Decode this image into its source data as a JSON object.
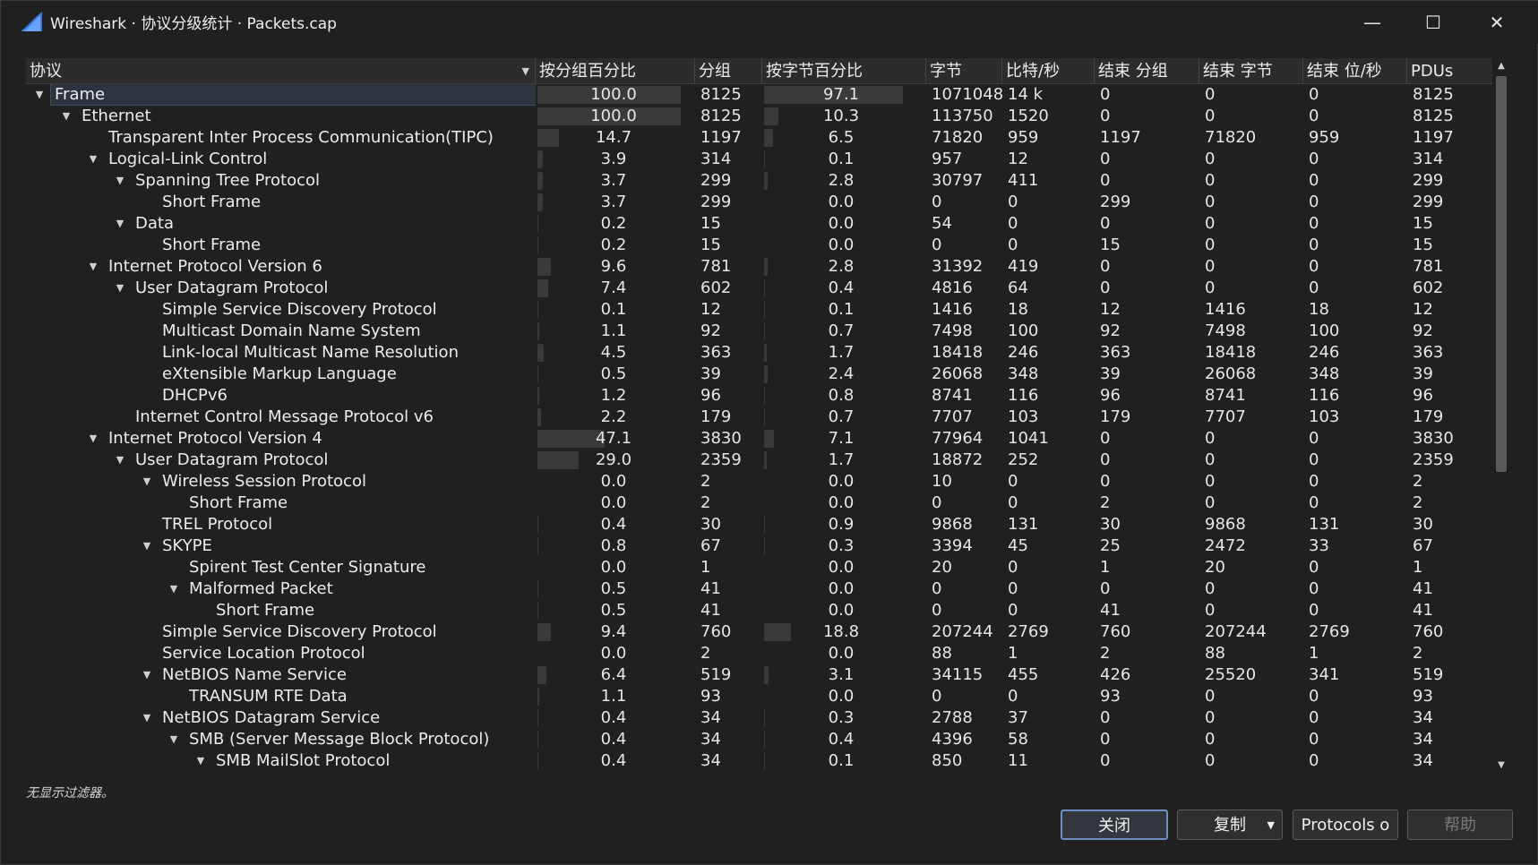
{
  "window": {
    "title": "Wireshark · 协议分级统计 · Packets.cap",
    "min_icon": "minimize-icon",
    "max_icon": "maximize-icon",
    "close_icon": "close-icon"
  },
  "columns": {
    "protocol": "协议",
    "pct_packets": "按分组百分比",
    "packets": "分组",
    "pct_bytes": "按字节百分比",
    "bytes": "字节",
    "bps": "比特/秒",
    "end_packets": "结束 分组",
    "end_bytes": "结束 字节",
    "end_bps": "结束 位/秒",
    "pdus": "PDUs"
  },
  "rows": [
    {
      "name": "Frame",
      "level": 0,
      "expanded": true,
      "pct": "100.0",
      "pkts": "8125",
      "bpct": "97.1",
      "bytes": "1071048",
      "bps": "14 k",
      "epk": "0",
      "eby": "0",
      "ebps": "0",
      "pdus": "8125",
      "selected": true
    },
    {
      "name": "Ethernet",
      "level": 1,
      "expanded": true,
      "pct": "100.0",
      "pkts": "8125",
      "bpct": "10.3",
      "bytes": "113750",
      "bps": "1520",
      "epk": "0",
      "eby": "0",
      "ebps": "0",
      "pdus": "8125"
    },
    {
      "name": "Transparent Inter Process Communication(TIPC)",
      "level": 2,
      "expanded": null,
      "pct": "14.7",
      "pkts": "1197",
      "bpct": "6.5",
      "bytes": "71820",
      "bps": "959",
      "epk": "1197",
      "eby": "71820",
      "ebps": "959",
      "pdus": "1197"
    },
    {
      "name": "Logical-Link Control",
      "level": 2,
      "expanded": true,
      "pct": "3.9",
      "pkts": "314",
      "bpct": "0.1",
      "bytes": "957",
      "bps": "12",
      "epk": "0",
      "eby": "0",
      "ebps": "0",
      "pdus": "314"
    },
    {
      "name": "Spanning Tree Protocol",
      "level": 3,
      "expanded": true,
      "pct": "3.7",
      "pkts": "299",
      "bpct": "2.8",
      "bytes": "30797",
      "bps": "411",
      "epk": "0",
      "eby": "0",
      "ebps": "0",
      "pdus": "299"
    },
    {
      "name": "Short Frame",
      "level": 4,
      "expanded": null,
      "pct": "3.7",
      "pkts": "299",
      "bpct": "0.0",
      "bytes": "0",
      "bps": "0",
      "epk": "299",
      "eby": "0",
      "ebps": "0",
      "pdus": "299"
    },
    {
      "name": "Data",
      "level": 3,
      "expanded": true,
      "pct": "0.2",
      "pkts": "15",
      "bpct": "0.0",
      "bytes": "54",
      "bps": "0",
      "epk": "0",
      "eby": "0",
      "ebps": "0",
      "pdus": "15"
    },
    {
      "name": "Short Frame",
      "level": 4,
      "expanded": null,
      "pct": "0.2",
      "pkts": "15",
      "bpct": "0.0",
      "bytes": "0",
      "bps": "0",
      "epk": "15",
      "eby": "0",
      "ebps": "0",
      "pdus": "15"
    },
    {
      "name": "Internet Protocol Version 6",
      "level": 2,
      "expanded": true,
      "pct": "9.6",
      "pkts": "781",
      "bpct": "2.8",
      "bytes": "31392",
      "bps": "419",
      "epk": "0",
      "eby": "0",
      "ebps": "0",
      "pdus": "781"
    },
    {
      "name": "User Datagram Protocol",
      "level": 3,
      "expanded": true,
      "pct": "7.4",
      "pkts": "602",
      "bpct": "0.4",
      "bytes": "4816",
      "bps": "64",
      "epk": "0",
      "eby": "0",
      "ebps": "0",
      "pdus": "602"
    },
    {
      "name": "Simple Service Discovery Protocol",
      "level": 4,
      "expanded": null,
      "pct": "0.1",
      "pkts": "12",
      "bpct": "0.1",
      "bytes": "1416",
      "bps": "18",
      "epk": "12",
      "eby": "1416",
      "ebps": "18",
      "pdus": "12"
    },
    {
      "name": "Multicast Domain Name System",
      "level": 4,
      "expanded": null,
      "pct": "1.1",
      "pkts": "92",
      "bpct": "0.7",
      "bytes": "7498",
      "bps": "100",
      "epk": "92",
      "eby": "7498",
      "ebps": "100",
      "pdus": "92"
    },
    {
      "name": "Link-local Multicast Name Resolution",
      "level": 4,
      "expanded": null,
      "pct": "4.5",
      "pkts": "363",
      "bpct": "1.7",
      "bytes": "18418",
      "bps": "246",
      "epk": "363",
      "eby": "18418",
      "ebps": "246",
      "pdus": "363"
    },
    {
      "name": "eXtensible Markup Language",
      "level": 4,
      "expanded": null,
      "pct": "0.5",
      "pkts": "39",
      "bpct": "2.4",
      "bytes": "26068",
      "bps": "348",
      "epk": "39",
      "eby": "26068",
      "ebps": "348",
      "pdus": "39"
    },
    {
      "name": "DHCPv6",
      "level": 4,
      "expanded": null,
      "pct": "1.2",
      "pkts": "96",
      "bpct": "0.8",
      "bytes": "8741",
      "bps": "116",
      "epk": "96",
      "eby": "8741",
      "ebps": "116",
      "pdus": "96"
    },
    {
      "name": "Internet Control Message Protocol v6",
      "level": 3,
      "expanded": null,
      "pct": "2.2",
      "pkts": "179",
      "bpct": "0.7",
      "bytes": "7707",
      "bps": "103",
      "epk": "179",
      "eby": "7707",
      "ebps": "103",
      "pdus": "179"
    },
    {
      "name": "Internet Protocol Version 4",
      "level": 2,
      "expanded": true,
      "pct": "47.1",
      "pkts": "3830",
      "bpct": "7.1",
      "bytes": "77964",
      "bps": "1041",
      "epk": "0",
      "eby": "0",
      "ebps": "0",
      "pdus": "3830"
    },
    {
      "name": "User Datagram Protocol",
      "level": 3,
      "expanded": true,
      "pct": "29.0",
      "pkts": "2359",
      "bpct": "1.7",
      "bytes": "18872",
      "bps": "252",
      "epk": "0",
      "eby": "0",
      "ebps": "0",
      "pdus": "2359"
    },
    {
      "name": "Wireless Session Protocol",
      "level": 4,
      "expanded": true,
      "pct": "0.0",
      "pkts": "2",
      "bpct": "0.0",
      "bytes": "10",
      "bps": "0",
      "epk": "0",
      "eby": "0",
      "ebps": "0",
      "pdus": "2"
    },
    {
      "name": "Short Frame",
      "level": 5,
      "expanded": null,
      "pct": "0.0",
      "pkts": "2",
      "bpct": "0.0",
      "bytes": "0",
      "bps": "0",
      "epk": "2",
      "eby": "0",
      "ebps": "0",
      "pdus": "2"
    },
    {
      "name": "TREL Protocol",
      "level": 4,
      "expanded": null,
      "pct": "0.4",
      "pkts": "30",
      "bpct": "0.9",
      "bytes": "9868",
      "bps": "131",
      "epk": "30",
      "eby": "9868",
      "ebps": "131",
      "pdus": "30"
    },
    {
      "name": "SKYPE",
      "level": 4,
      "expanded": true,
      "pct": "0.8",
      "pkts": "67",
      "bpct": "0.3",
      "bytes": "3394",
      "bps": "45",
      "epk": "25",
      "eby": "2472",
      "ebps": "33",
      "pdus": "67"
    },
    {
      "name": "Spirent Test Center Signature",
      "level": 5,
      "expanded": null,
      "pct": "0.0",
      "pkts": "1",
      "bpct": "0.0",
      "bytes": "20",
      "bps": "0",
      "epk": "1",
      "eby": "20",
      "ebps": "0",
      "pdus": "1"
    },
    {
      "name": "Malformed Packet",
      "level": 5,
      "expanded": true,
      "pct": "0.5",
      "pkts": "41",
      "bpct": "0.0",
      "bytes": "0",
      "bps": "0",
      "epk": "0",
      "eby": "0",
      "ebps": "0",
      "pdus": "41"
    },
    {
      "name": "Short Frame",
      "level": 6,
      "expanded": null,
      "pct": "0.5",
      "pkts": "41",
      "bpct": "0.0",
      "bytes": "0",
      "bps": "0",
      "epk": "41",
      "eby": "0",
      "ebps": "0",
      "pdus": "41"
    },
    {
      "name": "Simple Service Discovery Protocol",
      "level": 4,
      "expanded": null,
      "pct": "9.4",
      "pkts": "760",
      "bpct": "18.8",
      "bytes": "207244",
      "bps": "2769",
      "epk": "760",
      "eby": "207244",
      "ebps": "2769",
      "pdus": "760"
    },
    {
      "name": "Service Location Protocol",
      "level": 4,
      "expanded": null,
      "pct": "0.0",
      "pkts": "2",
      "bpct": "0.0",
      "bytes": "88",
      "bps": "1",
      "epk": "2",
      "eby": "88",
      "ebps": "1",
      "pdus": "2"
    },
    {
      "name": "NetBIOS Name Service",
      "level": 4,
      "expanded": true,
      "pct": "6.4",
      "pkts": "519",
      "bpct": "3.1",
      "bytes": "34115",
      "bps": "455",
      "epk": "426",
      "eby": "25520",
      "ebps": "341",
      "pdus": "519"
    },
    {
      "name": "TRANSUM RTE Data",
      "level": 5,
      "expanded": null,
      "pct": "1.1",
      "pkts": "93",
      "bpct": "0.0",
      "bytes": "0",
      "bps": "0",
      "epk": "93",
      "eby": "0",
      "ebps": "0",
      "pdus": "93"
    },
    {
      "name": "NetBIOS Datagram Service",
      "level": 4,
      "expanded": true,
      "pct": "0.4",
      "pkts": "34",
      "bpct": "0.3",
      "bytes": "2788",
      "bps": "37",
      "epk": "0",
      "eby": "0",
      "ebps": "0",
      "pdus": "34"
    },
    {
      "name": "SMB (Server Message Block Protocol)",
      "level": 5,
      "expanded": true,
      "pct": "0.4",
      "pkts": "34",
      "bpct": "0.4",
      "bytes": "4396",
      "bps": "58",
      "epk": "0",
      "eby": "0",
      "ebps": "0",
      "pdus": "34"
    },
    {
      "name": "SMB MailSlot Protocol",
      "level": 6,
      "expanded": true,
      "pct": "0.4",
      "pkts": "34",
      "bpct": "0.1",
      "bytes": "850",
      "bps": "11",
      "epk": "0",
      "eby": "0",
      "ebps": "0",
      "pdus": "34"
    }
  ],
  "status": {
    "filter_text": "无显示过滤器。"
  },
  "buttons": {
    "close": "关闭",
    "copy": "复制",
    "protocols": "Protocols o",
    "help": "帮助"
  },
  "colors": {
    "accent": "#6d8fc2",
    "bar": "#3a3a3a",
    "selection": "#2d3440"
  }
}
